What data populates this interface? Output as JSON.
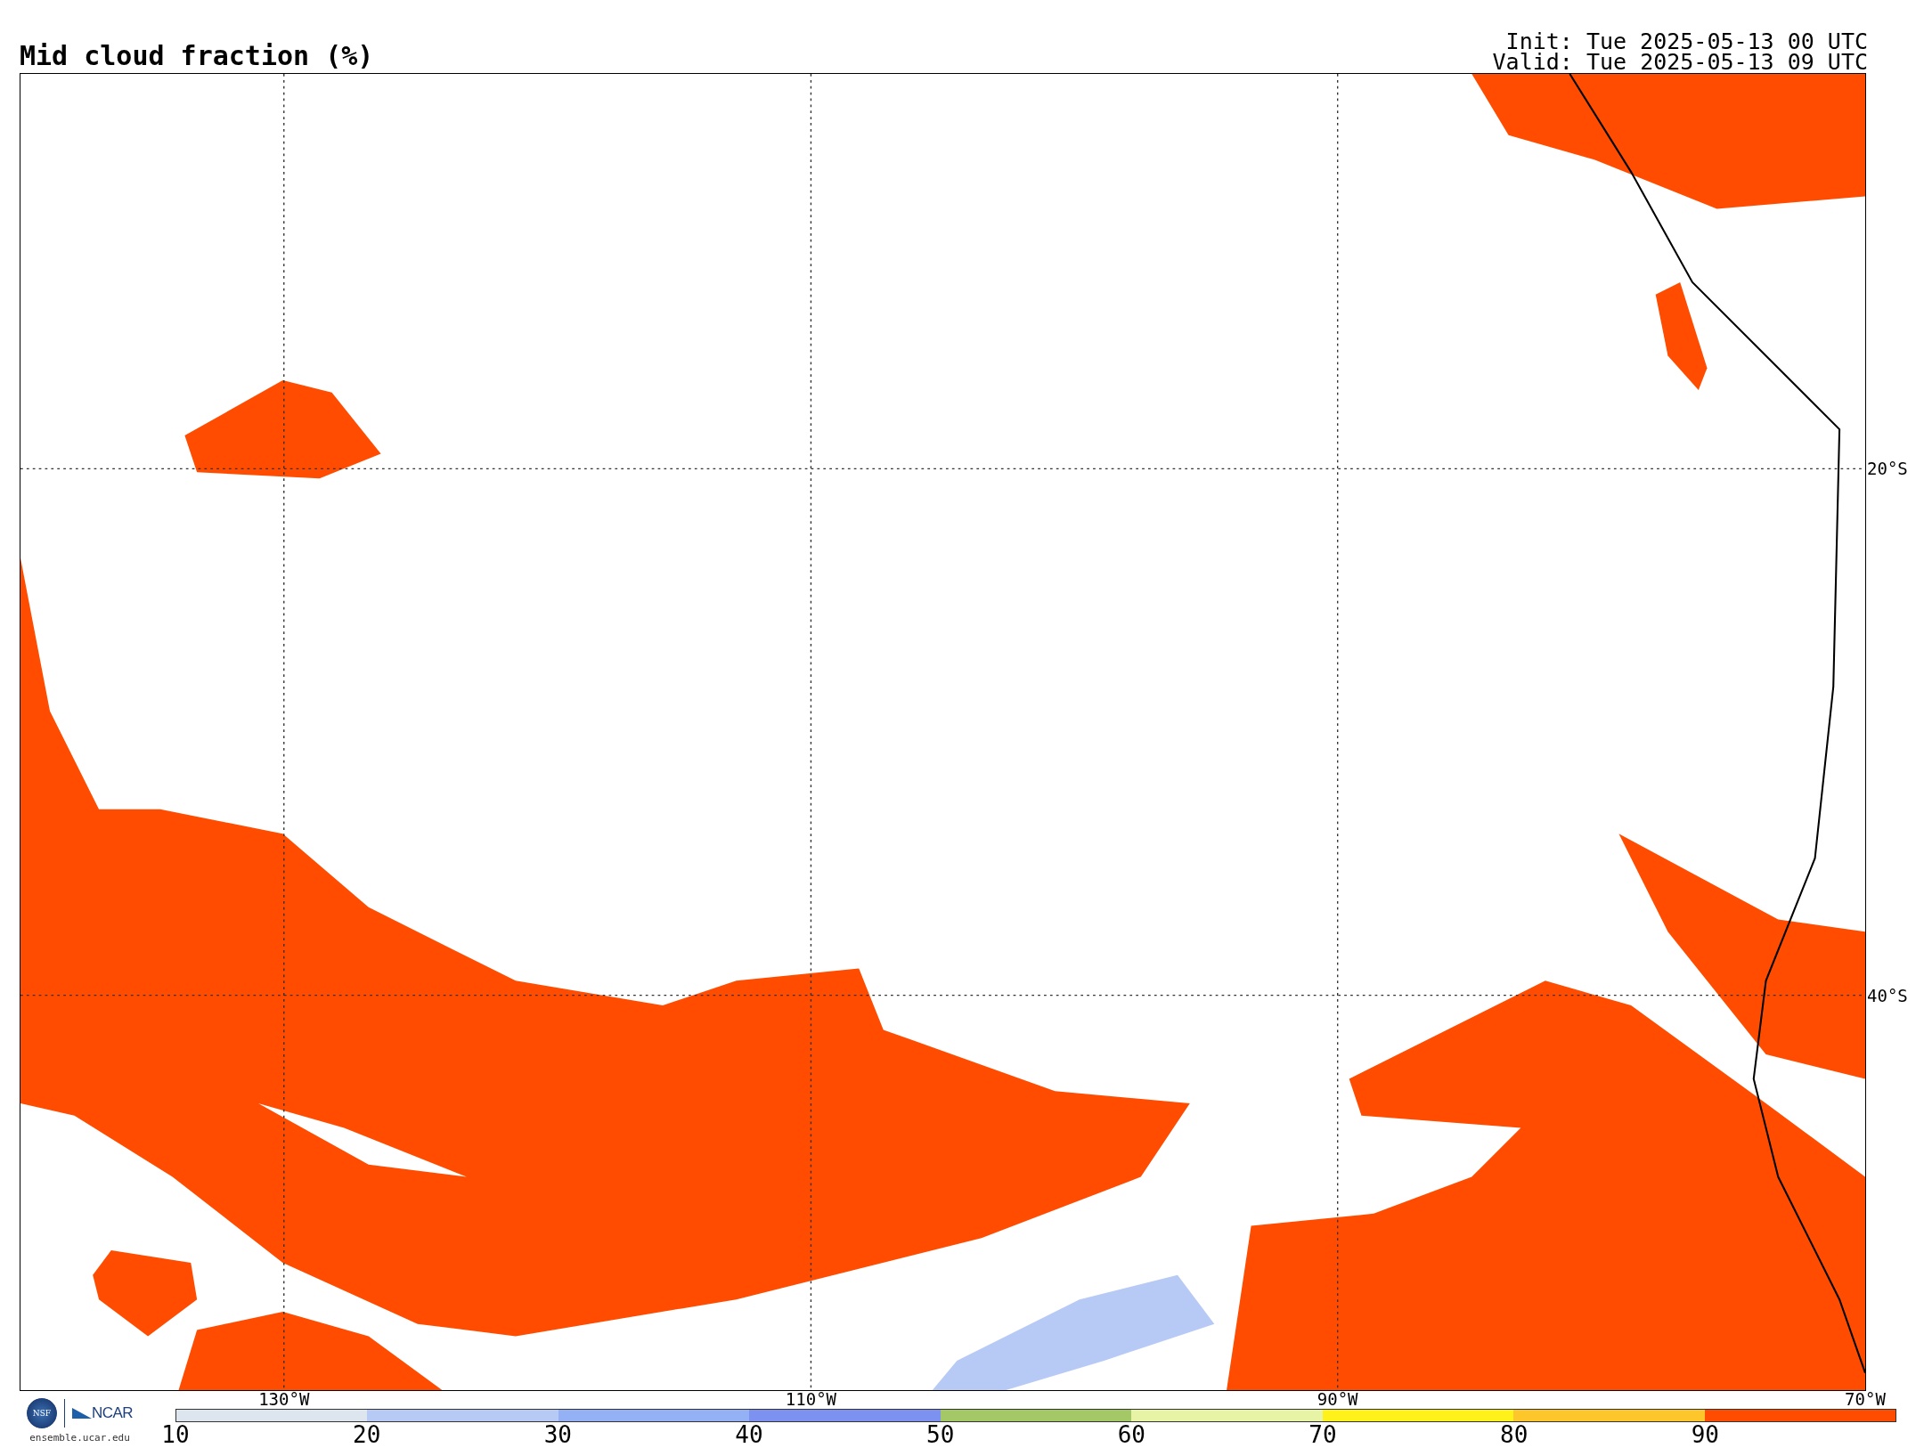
{
  "title": "Mid cloud fraction (%)",
  "init": "Init: Tue 2025-05-13 00 UTC",
  "valid": "Valid: Tue 2025-05-13 09 UTC",
  "map": {
    "lat_labels": [
      "20°S",
      "40°S"
    ],
    "lon_labels": [
      "130°W",
      "110°W",
      "90°W",
      "70°W"
    ]
  },
  "logo": {
    "nsf": "NSF",
    "ncar": "NCAR",
    "site": "ensemble.ucar.edu"
  },
  "colorbar": {
    "ticks": [
      "10",
      "20",
      "30",
      "40",
      "50",
      "60",
      "70",
      "80",
      "90"
    ],
    "segments": [
      {
        "color": "#dde6ee"
      },
      {
        "color": "#b7c9f5"
      },
      {
        "color": "#94b1f6"
      },
      {
        "color": "#7d92f0"
      },
      {
        "color": "#a4c865"
      },
      {
        "color": "#e7f3a5"
      },
      {
        "color": "#fff21a"
      },
      {
        "color": "#fdc62b"
      },
      {
        "color": "#ff4c00"
      }
    ]
  }
}
